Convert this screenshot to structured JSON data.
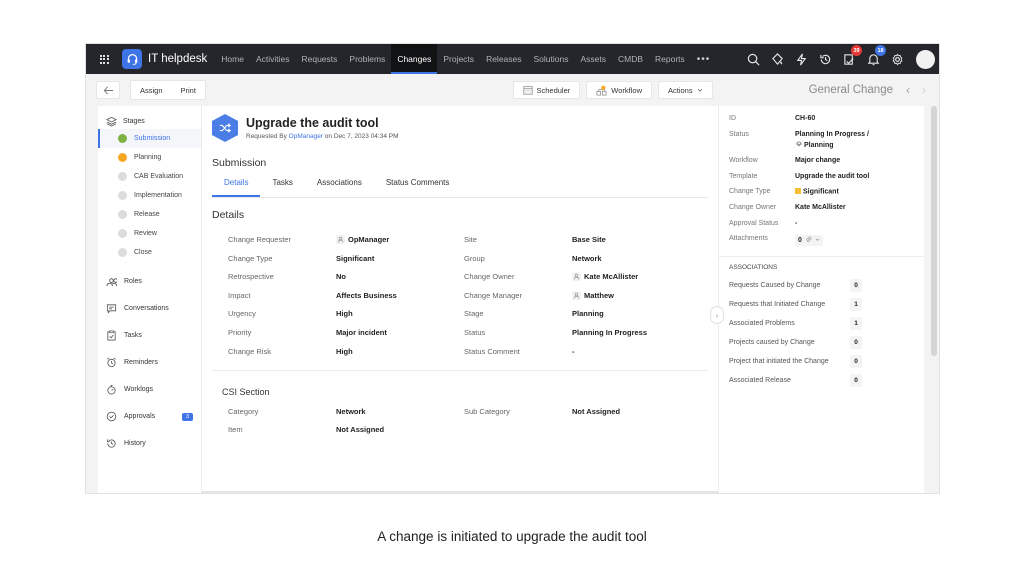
{
  "topnav": {
    "brand": "IT helpdesk",
    "items": [
      {
        "label": "Home",
        "active": false
      },
      {
        "label": "Activities",
        "active": false
      },
      {
        "label": "Requests",
        "active": false
      },
      {
        "label": "Problems",
        "active": false
      },
      {
        "label": "Changes",
        "active": true
      },
      {
        "label": "Projects",
        "active": false
      },
      {
        "label": "Releases",
        "active": false
      },
      {
        "label": "Solutions",
        "active": false
      },
      {
        "label": "Assets",
        "active": false
      },
      {
        "label": "CMDB",
        "active": false
      },
      {
        "label": "Reports",
        "active": false
      }
    ],
    "more": "•••",
    "icons": [
      "search-icon",
      "ai-sparkle-icon",
      "lightning-icon",
      "history-icon",
      "approvals-icon",
      "bell-icon",
      "gear-icon",
      "avatar"
    ],
    "approvals_badge": "39",
    "notifications_badge": "18"
  },
  "toolbar": {
    "back_icon": "arrow-left-icon",
    "assign": "Assign",
    "print": "Print",
    "scheduler": "Scheduler",
    "workflow": "Workflow",
    "actions": "Actions",
    "template_title": "General Change"
  },
  "left_panel": {
    "stages_label": "Stages",
    "stages": [
      {
        "label": "Submission",
        "state": "active"
      },
      {
        "label": "Planning",
        "state": "in-progress"
      },
      {
        "label": "CAB Evaluation",
        "state": "pending"
      },
      {
        "label": "Implementation",
        "state": "pending"
      },
      {
        "label": "Release",
        "state": "pending"
      },
      {
        "label": "Review",
        "state": "pending"
      },
      {
        "label": "Close",
        "state": "pending"
      }
    ],
    "items": [
      {
        "label": "Roles",
        "icon": "roles-icon"
      },
      {
        "label": "Conversations",
        "icon": "conversation-icon"
      },
      {
        "label": "Tasks",
        "icon": "clipboard-icon"
      },
      {
        "label": "Reminders",
        "icon": "alarm-clock-icon"
      },
      {
        "label": "Worklogs",
        "icon": "stopwatch-icon"
      },
      {
        "label": "Approvals",
        "icon": "check-circle-icon",
        "badge": "3"
      },
      {
        "label": "History",
        "icon": "history-icon"
      }
    ]
  },
  "main": {
    "title": "Upgrade the audit tool",
    "requested_by_prefix": "Requested By",
    "requested_by": "OpManager",
    "requested_on": "on Dec 7, 2023 04:34 PM",
    "stage_name": "Submission",
    "tabs": [
      {
        "label": "Details",
        "active": true
      },
      {
        "label": "Tasks",
        "active": false
      },
      {
        "label": "Associations",
        "active": false
      },
      {
        "label": "Status Comments",
        "active": false
      }
    ],
    "details_title": "Details",
    "details": [
      {
        "label": "Change Requester",
        "value": "OpManager",
        "user": true,
        "label2": "Site",
        "value2": "Base Site",
        "user2": false
      },
      {
        "label": "Change Type",
        "value": "Significant",
        "user": false,
        "label2": "Group",
        "value2": "Network",
        "user2": false
      },
      {
        "label": "Retrospective",
        "value": "No",
        "user": false,
        "label2": "Change Owner",
        "value2": "Kate McAllister",
        "user2": true
      },
      {
        "label": "Impact",
        "value": "Affects Business",
        "user": false,
        "label2": "Change Manager",
        "value2": "Matthew",
        "user2": true
      },
      {
        "label": "Urgency",
        "value": "High",
        "user": false,
        "label2": "Stage",
        "value2": "Planning",
        "user2": false
      },
      {
        "label": "Priority",
        "value": "Major incident",
        "user": false,
        "label2": "Status",
        "value2": "Planning In Progress",
        "user2": false
      },
      {
        "label": "Change Risk",
        "value": "High",
        "user": false,
        "label2": "Status Comment",
        "value2": "-",
        "user2": false
      }
    ],
    "csi_title": "CSI Section",
    "csi": [
      {
        "label": "Category",
        "value": "Network",
        "label2": "Sub Category",
        "value2": "Not Assigned"
      },
      {
        "label": "Item",
        "value": "Not Assigned",
        "label2": "",
        "value2": ""
      }
    ]
  },
  "right_panel": {
    "fields": [
      {
        "label": "ID",
        "value": "CH-60"
      },
      {
        "label": "Status",
        "value": "Planning In Progress /",
        "value_line2": "Planning"
      },
      {
        "label": "Workflow",
        "value": "Major change"
      },
      {
        "label": "Template",
        "value": "Upgrade the audit tool"
      },
      {
        "label": "Change Type",
        "value": "Significant",
        "color": "#f5c033"
      },
      {
        "label": "Change Owner",
        "value": "Kate McAllister"
      },
      {
        "label": "Approval Status",
        "value": "-"
      },
      {
        "label": "Attachments",
        "value": "0"
      }
    ],
    "associations_title": "ASSOCIATIONS",
    "associations": [
      {
        "label": "Requests Caused by Change",
        "count": "0"
      },
      {
        "label": "Requests that Initiated Change",
        "count": "1"
      },
      {
        "label": "Associated Problems",
        "count": "1"
      },
      {
        "label": "Projects caused by Change",
        "count": "0"
      },
      {
        "label": "Project that initiated the Change",
        "count": "0"
      },
      {
        "label": "Associated Release",
        "count": "0"
      }
    ]
  },
  "caption": "A change is initiated to upgrade the audit tool",
  "colors": {
    "accent": "#3e74e6",
    "nav_bg": "#24262b",
    "stage_done": "#7cb342",
    "stage_progress": "#f5a623",
    "stage_pending": "#dcdcdc",
    "badge_red": "#e53935",
    "significant": "#f5c033"
  }
}
